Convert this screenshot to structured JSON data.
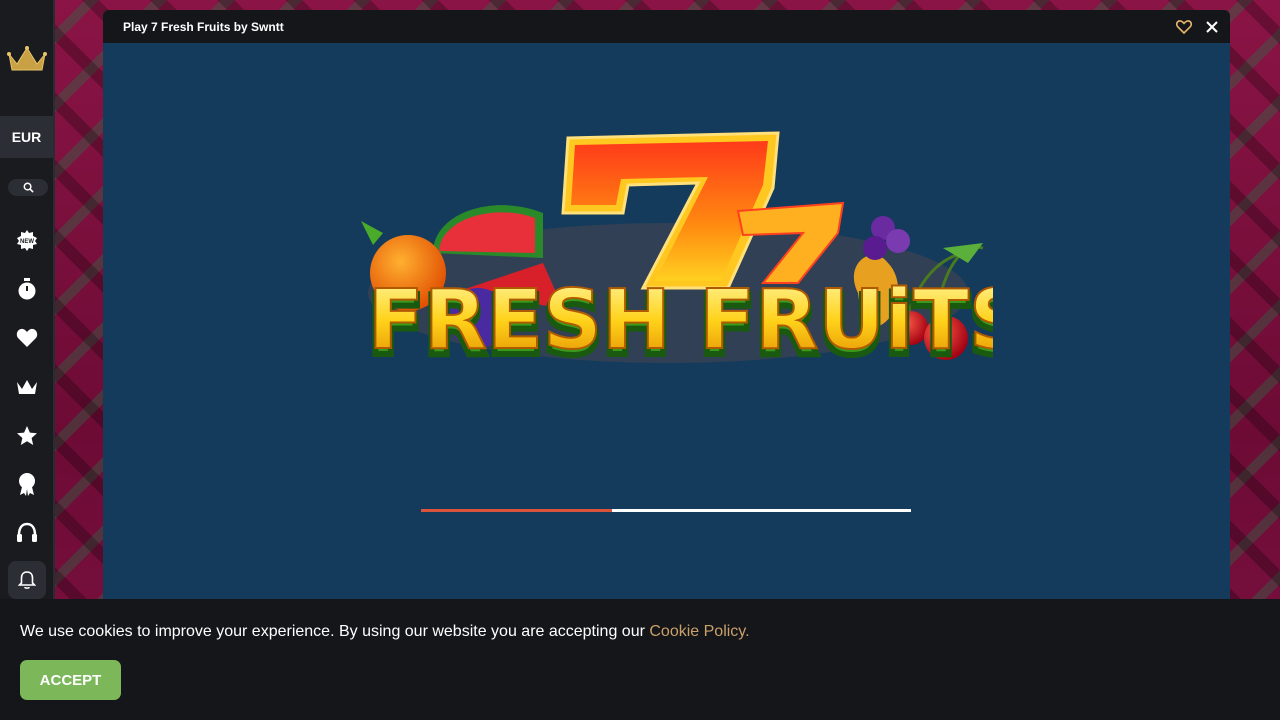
{
  "sidebar": {
    "currency": "EUR",
    "icons": [
      "crown-logo-icon",
      "search-icon",
      "new-badge-icon",
      "stopwatch-icon",
      "heart-icon",
      "crown-icon",
      "star-icon",
      "award-icon",
      "headset-icon",
      "bell-icon"
    ]
  },
  "game": {
    "title": "Play 7 Fresh Fruits by Swntt",
    "logo_text": "FRESH FRUiTS",
    "logo_digit": "7",
    "loading_progress": 0.39
  },
  "cookie": {
    "text": "We use cookies to improve your experience. By using our website you are accepting our ",
    "link": "Cookie Policy.",
    "accept_label": "ACCEPT"
  },
  "colors": {
    "accent": "#c9a06a",
    "accept": "#7cb75a",
    "progress": "#d9533d",
    "game_bg": "#153b5c"
  }
}
